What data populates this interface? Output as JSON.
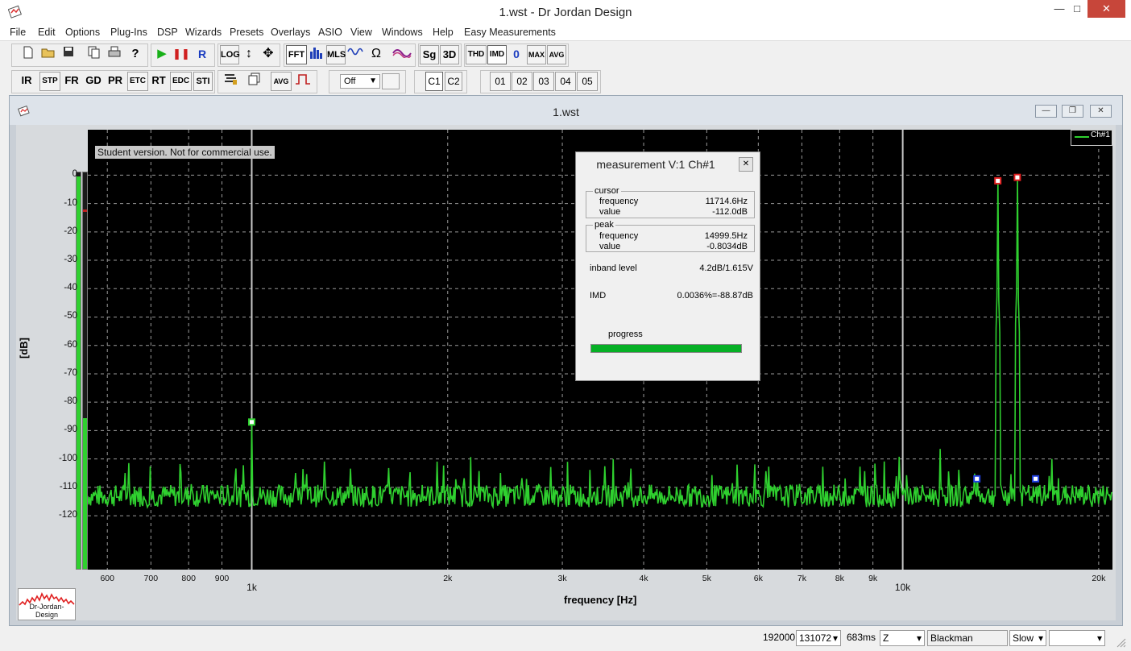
{
  "app": {
    "title": "1.wst - Dr Jordan Design"
  },
  "menu": [
    "File",
    "Edit",
    "Options",
    "Plug-Ins",
    "DSP",
    "Wizards",
    "Presets",
    "Overlays",
    "ASIO",
    "View",
    "Windows",
    "Help",
    "Easy Measurements"
  ],
  "toolbar1": [
    "LOG",
    "FFT",
    "MLS",
    "Sg",
    "3D",
    "THD",
    "IMD",
    "0",
    "MAX",
    "AVG"
  ],
  "toolbar2": [
    "IR",
    "STP",
    "FR",
    "GD",
    "PR",
    "ETC",
    "RT",
    "EDC",
    "STI",
    "AVG",
    "Off",
    "C1",
    "C2",
    "01",
    "02",
    "03",
    "04",
    "05"
  ],
  "child_window": {
    "title": "1.wst"
  },
  "overlay": {
    "student_note": "Student version. Not for commercial use.",
    "legend": "Ch#1",
    "logo_text": "Dr-Jordan-Design"
  },
  "chart_data": {
    "type": "line",
    "xlabel": "frequency [Hz]",
    "ylabel": "[dB]",
    "xscale": "log",
    "xlim": [
      560,
      21000
    ],
    "ylim": [
      -139,
      16
    ],
    "y_ticks": [
      0,
      -10,
      -20,
      -30,
      -40,
      -50,
      -60,
      -70,
      -80,
      -90,
      -100,
      -110,
      -120
    ],
    "x_ticks_minor": [
      "600",
      "700",
      "800",
      "900",
      "2k",
      "3k",
      "4k",
      "5k",
      "6k",
      "7k",
      "8k",
      "9k",
      "20k"
    ],
    "x_ticks_major": [
      "1k",
      "10k"
    ],
    "series": [
      {
        "name": "Ch#1",
        "color": "#2fd02f",
        "noise_floor_db": -113,
        "peaks": [
          [
            1000,
            -87
          ],
          [
            14000,
            -2
          ],
          [
            15000,
            -0.8
          ]
        ]
      }
    ],
    "markers": [
      {
        "f": 1000,
        "db": -87,
        "kind": "harmonic"
      },
      {
        "f": 14000,
        "db": -2,
        "kind": "peak"
      },
      {
        "f": 15000,
        "db": -0.8,
        "kind": "peak"
      },
      {
        "f": 13000,
        "db": -107,
        "kind": "imd"
      },
      {
        "f": 16000,
        "db": -107,
        "kind": "imd"
      }
    ]
  },
  "meter": {
    "left_level": 0.99,
    "right_level": 0.38
  },
  "measurement": {
    "title": "measurement V:1 Ch#1",
    "cursor": {
      "label": "cursor",
      "frequency_label": "frequency",
      "frequency": "11714.6Hz",
      "value_label": "value",
      "value": "-112.0dB"
    },
    "peak": {
      "label": "peak",
      "frequency_label": "frequency",
      "frequency": "14999.5Hz",
      "value_label": "value",
      "value": "-0.8034dB"
    },
    "inband_label": "inband level",
    "inband_value": "4.2dB/1.615V",
    "imd_label": "IMD",
    "imd_value": "0.0036%=-88.87dB",
    "progress_label": "progress",
    "progress": 1.0
  },
  "status": {
    "rate": "192000",
    "fft_size": "131072",
    "time": "683ms",
    "weighting": "Z",
    "window": "Blackman",
    "speed": "Slow",
    "extra": ""
  }
}
